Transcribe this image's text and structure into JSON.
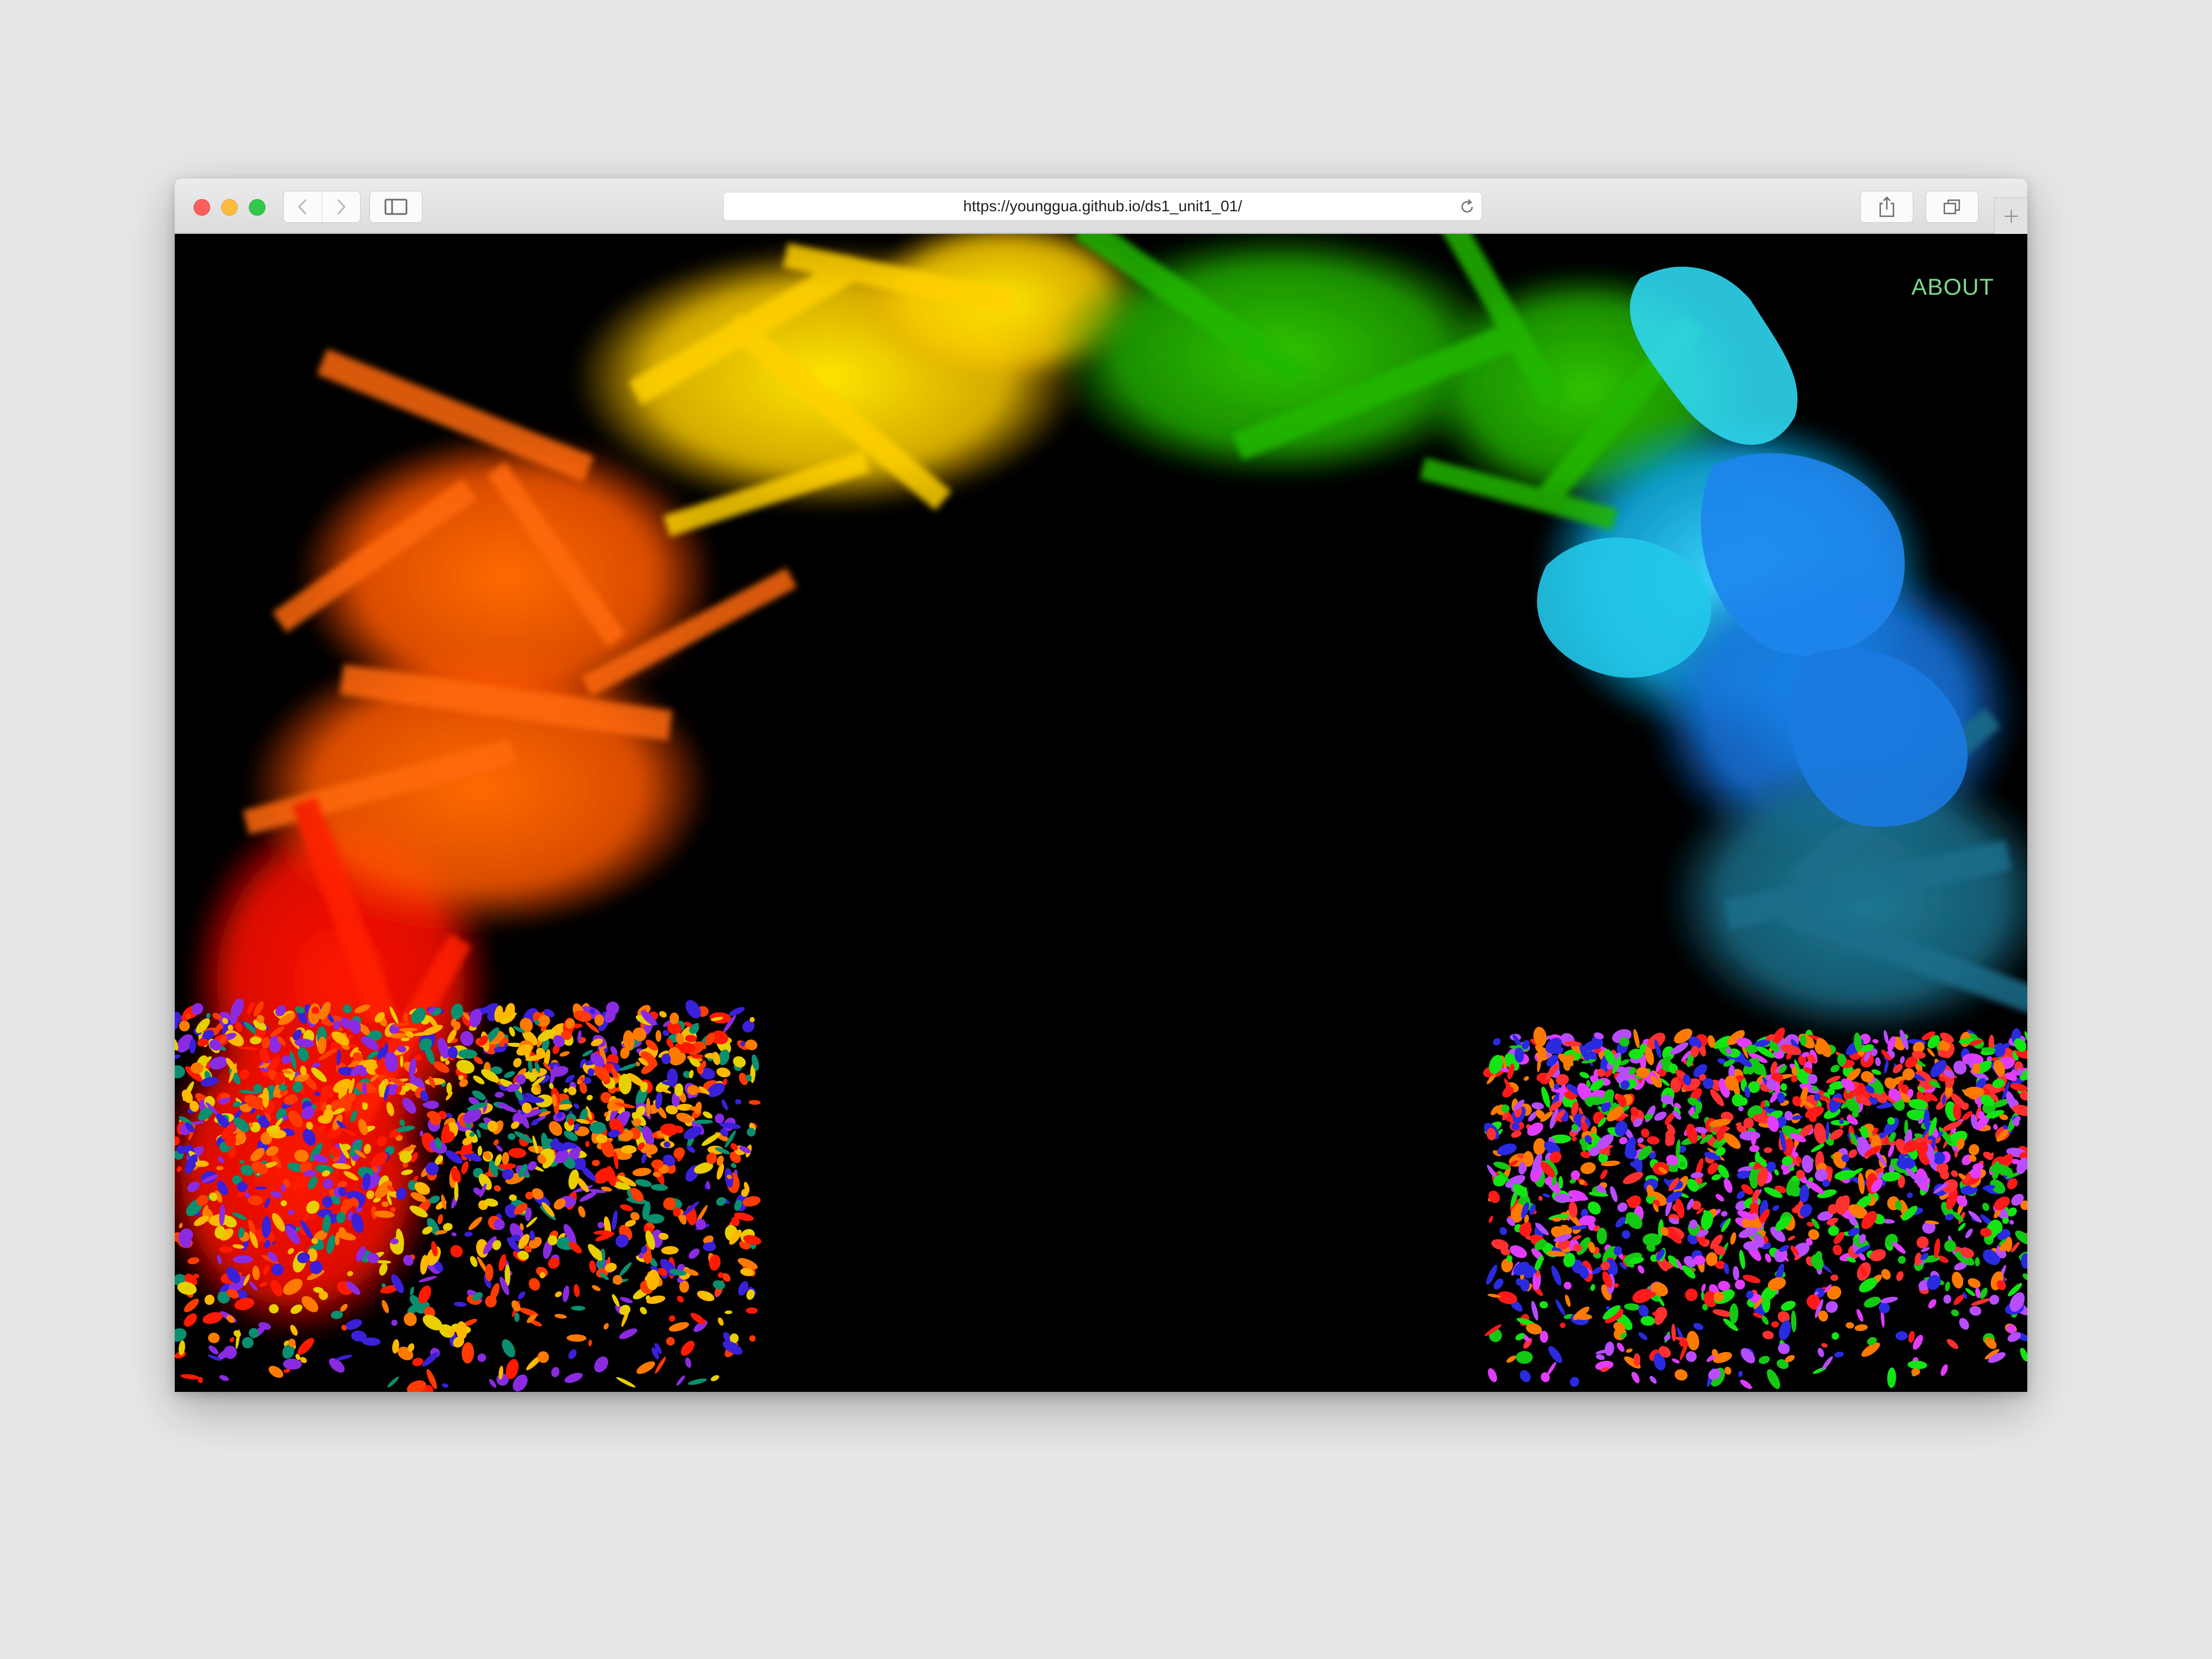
{
  "browser": {
    "url": "https://younggua.github.io/ds1_unit1_01/",
    "nav_back_icon": "chevron-left-icon",
    "nav_forward_icon": "chevron-right-icon",
    "sidebar_icon": "sidebar-icon",
    "share_icon": "share-icon",
    "tabs_icon": "tabs-overview-icon",
    "new_tab_icon": "plus-icon",
    "reload_icon": "reload-icon"
  },
  "page": {
    "nav_about": "ABOUT",
    "background_color": "#000000",
    "artwork_palette": [
      "#ff1a00",
      "#ff6a00",
      "#ffe400",
      "#2fc400",
      "#0fb8e8",
      "#1578e0",
      "#1a6e8c",
      "#b84cff",
      "#f2a08a"
    ]
  }
}
